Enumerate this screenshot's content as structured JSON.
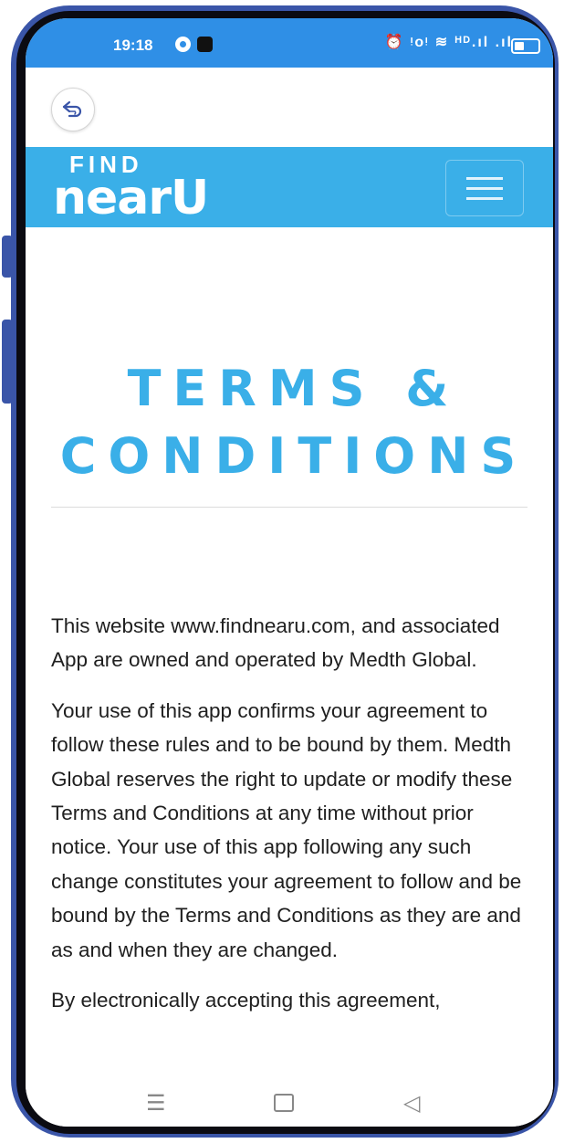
{
  "status_bar": {
    "time": "19:18",
    "right_indicators": "⏰ ᵎᴏᵎ ≋ ᴴᴰ.ıl .ıl"
  },
  "icons": {
    "back": "back-arrow-icon",
    "menu": "hamburger-menu-icon"
  },
  "brand": {
    "find": "FIND",
    "nearu": "nearU"
  },
  "page": {
    "title": "TERMS & CONDITIONS",
    "paragraphs": [
      "This website www.findnearu.com, and associated App are owned and operated by Medth Global.",
      "Your use of this app confirms your agreement to follow these rules and to be bound by them. Medth Global reserves the right to update or modify these Terms and Conditions at any time without prior notice. Your use of this app following any such change constitutes your agreement to follow and be bound by the Terms and Conditions as they are and as and when they are changed.",
      "By electronically accepting this agreement,"
    ]
  },
  "system_nav": {
    "menu": "☰",
    "back": "◁"
  },
  "colors": {
    "status_bar": "#2f8fe6",
    "brand_blue": "#3aafe8",
    "frame": "#3a55a8"
  }
}
